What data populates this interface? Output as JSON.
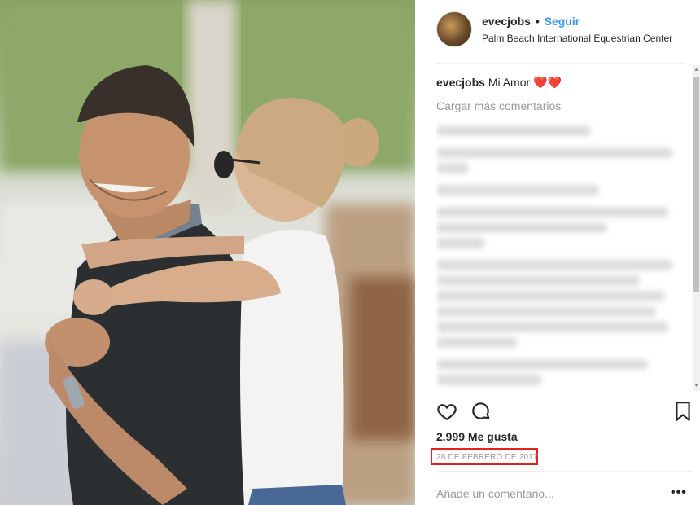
{
  "post": {
    "username": "evecjobs",
    "separator": "•",
    "follow_label": "Seguir",
    "location": "Palm Beach International Equestrian Center",
    "caption_user": "evecjobs",
    "caption_text": "Mi Amor ❤️❤️",
    "load_more": "Cargar más comentarios",
    "likes": "2.999 Me gusta",
    "date": "28 DE FEBRERO DE 2017",
    "add_comment_placeholder": "Añade un comentario...",
    "more_options": "•••"
  },
  "icons": {
    "like": "heart-icon",
    "comment": "comment-icon",
    "save": "bookmark-icon",
    "more": "ellipsis-icon"
  },
  "colors": {
    "follow": "#3897f0",
    "highlight_box": "#e0231f"
  }
}
